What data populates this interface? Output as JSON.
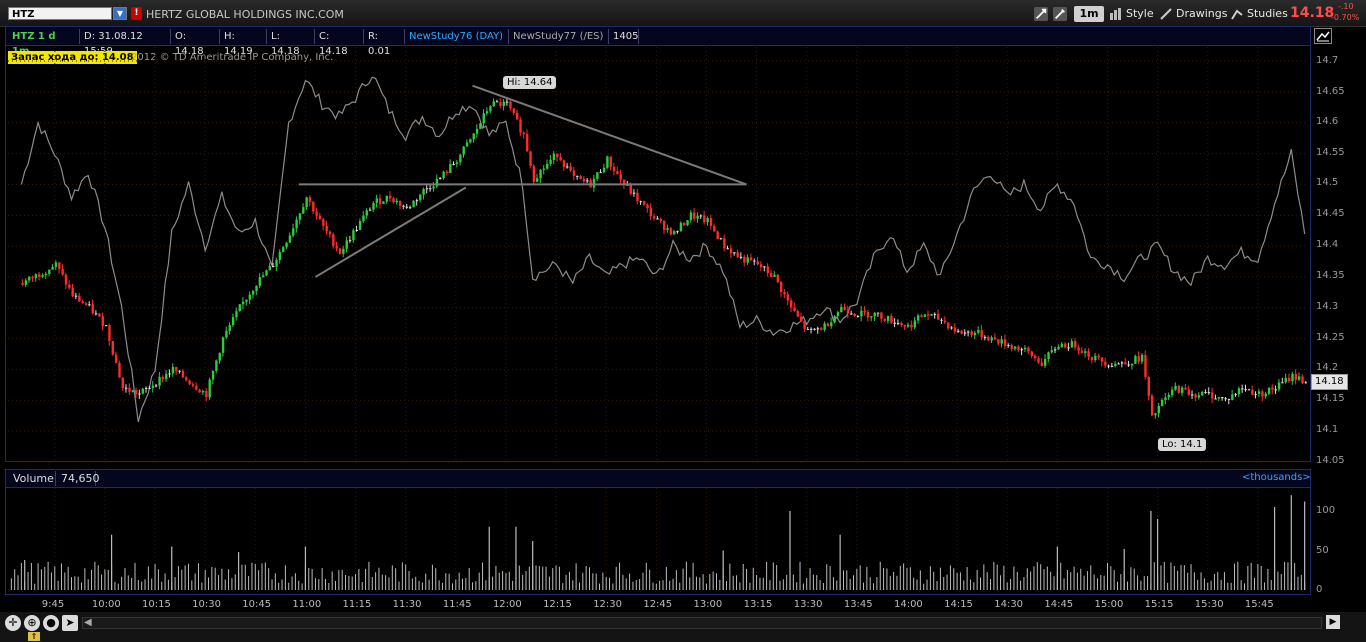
{
  "toolbar": {
    "symbol": "HTZ",
    "company": "HERTZ GLOBAL HOLDINGS INC.COM",
    "info_icon": "!",
    "timeframe": "1m",
    "style_label": "Style",
    "drawings_label": "Drawings",
    "studies_label": "Studies",
    "last_price": "14.18",
    "change_abs": "-.10",
    "change_pct": "-0.70%"
  },
  "infobar": {
    "symbol_period": "HTZ 1 d 1m",
    "date": "D: 31.08.12 15:59",
    "open": "O: 14.18",
    "high": "H: 14.19",
    "low": "L: 14.18",
    "close": "C: 14.18",
    "range": "R: 0.01",
    "study76": "NewStudy76 (DAY)",
    "study77": "NewStudy77 (/ES)",
    "study77_value": "1405"
  },
  "overlay": {
    "distance_label": "Запас хода до: 14.08",
    "copyright": "2012 © TD Ameritrade IP Company, Inc.",
    "hi_label": "Hi: 14.64",
    "lo_label": "Lo: 14.1",
    "current_price": "14.18"
  },
  "volume": {
    "label": "Volume",
    "value": "74,650",
    "units": "<thousands>"
  },
  "chart_data": {
    "type": "candlestick",
    "symbol": "HTZ",
    "interval": "1m",
    "high": 14.64,
    "low": 14.1,
    "last": 14.18,
    "y_ticks": [
      "14.7",
      "14.65",
      "14.6",
      "14.55",
      "14.5",
      "14.45",
      "14.4",
      "14.35",
      "14.3",
      "14.25",
      "14.2",
      "14.15",
      "14.1",
      "14.05"
    ],
    "y_range": [
      14.05,
      14.7
    ],
    "x_ticks": [
      "9:45",
      "10:00",
      "10:15",
      "10:30",
      "10:45",
      "11:00",
      "11:15",
      "11:30",
      "11:45",
      "12:00",
      "12:15",
      "12:30",
      "12:45",
      "13:00",
      "13:15",
      "13:30",
      "13:45",
      "14:00",
      "14:15",
      "14:30",
      "14:45",
      "15:00",
      "15:15",
      "15:30",
      "15:45"
    ],
    "volume_ticks": [
      "100",
      "50",
      "0"
    ],
    "price_path": [
      {
        "t": "9:35",
        "p": 14.34
      },
      {
        "t": "9:45",
        "p": 14.37
      },
      {
        "t": "9:50",
        "p": 14.32
      },
      {
        "t": "9:55",
        "p": 14.3
      },
      {
        "t": "10:00",
        "p": 14.27
      },
      {
        "t": "10:05",
        "p": 14.17
      },
      {
        "t": "10:10",
        "p": 14.16
      },
      {
        "t": "10:15",
        "p": 14.18
      },
      {
        "t": "10:20",
        "p": 14.2
      },
      {
        "t": "10:25",
        "p": 14.18
      },
      {
        "t": "10:30",
        "p": 14.16
      },
      {
        "t": "10:35",
        "p": 14.25
      },
      {
        "t": "10:40",
        "p": 14.3
      },
      {
        "t": "10:45",
        "p": 14.34
      },
      {
        "t": "10:50",
        "p": 14.37
      },
      {
        "t": "10:55",
        "p": 14.42
      },
      {
        "t": "11:00",
        "p": 14.48
      },
      {
        "t": "11:05",
        "p": 14.43
      },
      {
        "t": "11:10",
        "p": 14.39
      },
      {
        "t": "11:15",
        "p": 14.43
      },
      {
        "t": "11:20",
        "p": 14.47
      },
      {
        "t": "11:25",
        "p": 14.48
      },
      {
        "t": "11:30",
        "p": 14.46
      },
      {
        "t": "11:35",
        "p": 14.49
      },
      {
        "t": "11:40",
        "p": 14.51
      },
      {
        "t": "11:45",
        "p": 14.54
      },
      {
        "t": "11:50",
        "p": 14.58
      },
      {
        "t": "11:55",
        "p": 14.63
      },
      {
        "t": "12:00",
        "p": 14.63
      },
      {
        "t": "12:05",
        "p": 14.58
      },
      {
        "t": "12:08",
        "p": 14.51
      },
      {
        "t": "12:15",
        "p": 14.55
      },
      {
        "t": "12:20",
        "p": 14.51
      },
      {
        "t": "12:25",
        "p": 14.5
      },
      {
        "t": "12:30",
        "p": 14.54
      },
      {
        "t": "12:35",
        "p": 14.5
      },
      {
        "t": "12:40",
        "p": 14.47
      },
      {
        "t": "12:45",
        "p": 14.44
      },
      {
        "t": "12:50",
        "p": 14.42
      },
      {
        "t": "12:55",
        "p": 14.45
      },
      {
        "t": "13:00",
        "p": 14.44
      },
      {
        "t": "13:05",
        "p": 14.4
      },
      {
        "t": "13:10",
        "p": 14.38
      },
      {
        "t": "13:15",
        "p": 14.37
      },
      {
        "t": "13:20",
        "p": 14.35
      },
      {
        "t": "13:25",
        "p": 14.3
      },
      {
        "t": "13:30",
        "p": 14.26
      },
      {
        "t": "13:35",
        "p": 14.27
      },
      {
        "t": "13:40",
        "p": 14.3
      },
      {
        "t": "13:45",
        "p": 14.29
      },
      {
        "t": "13:50",
        "p": 14.29
      },
      {
        "t": "13:55",
        "p": 14.28
      },
      {
        "t": "14:00",
        "p": 14.27
      },
      {
        "t": "14:05",
        "p": 14.29
      },
      {
        "t": "14:10",
        "p": 14.28
      },
      {
        "t": "14:15",
        "p": 14.26
      },
      {
        "t": "14:20",
        "p": 14.26
      },
      {
        "t": "14:25",
        "p": 14.25
      },
      {
        "t": "14:30",
        "p": 14.24
      },
      {
        "t": "14:35",
        "p": 14.23
      },
      {
        "t": "14:40",
        "p": 14.21
      },
      {
        "t": "14:45",
        "p": 14.24
      },
      {
        "t": "14:50",
        "p": 14.24
      },
      {
        "t": "14:55",
        "p": 14.22
      },
      {
        "t": "15:00",
        "p": 14.21
      },
      {
        "t": "15:05",
        "p": 14.21
      },
      {
        "t": "15:10",
        "p": 14.22
      },
      {
        "t": "15:13",
        "p": 14.12
      },
      {
        "t": "15:15",
        "p": 14.14
      },
      {
        "t": "15:20",
        "p": 14.17
      },
      {
        "t": "15:25",
        "p": 14.16
      },
      {
        "t": "15:30",
        "p": 14.16
      },
      {
        "t": "15:35",
        "p": 14.15
      },
      {
        "t": "15:40",
        "p": 14.17
      },
      {
        "t": "15:45",
        "p": 14.16
      },
      {
        "t": "15:50",
        "p": 14.17
      },
      {
        "t": "15:55",
        "p": 14.19
      },
      {
        "t": "15:59",
        "p": 14.18
      }
    ],
    "comparison_path": [
      {
        "t": "9:35",
        "p": 14.5
      },
      {
        "t": "9:40",
        "p": 14.6
      },
      {
        "t": "9:45",
        "p": 14.55
      },
      {
        "t": "9:50",
        "p": 14.48
      },
      {
        "t": "9:55",
        "p": 14.52
      },
      {
        "t": "10:00",
        "p": 14.43
      },
      {
        "t": "10:05",
        "p": 14.3
      },
      {
        "t": "10:10",
        "p": 14.12
      },
      {
        "t": "10:15",
        "p": 14.2
      },
      {
        "t": "10:20",
        "p": 14.42
      },
      {
        "t": "10:25",
        "p": 14.5
      },
      {
        "t": "10:30",
        "p": 14.4
      },
      {
        "t": "10:35",
        "p": 14.48
      },
      {
        "t": "10:40",
        "p": 14.42
      },
      {
        "t": "10:45",
        "p": 14.44
      },
      {
        "t": "10:50",
        "p": 14.36
      },
      {
        "t": "10:55",
        "p": 14.6
      },
      {
        "t": "11:00",
        "p": 14.67
      },
      {
        "t": "11:05",
        "p": 14.63
      },
      {
        "t": "11:10",
        "p": 14.61
      },
      {
        "t": "11:15",
        "p": 14.64
      },
      {
        "t": "11:20",
        "p": 14.68
      },
      {
        "t": "11:25",
        "p": 14.62
      },
      {
        "t": "11:30",
        "p": 14.58
      },
      {
        "t": "11:35",
        "p": 14.61
      },
      {
        "t": "11:40",
        "p": 14.58
      },
      {
        "t": "11:45",
        "p": 14.62
      },
      {
        "t": "11:50",
        "p": 14.63
      },
      {
        "t": "11:55",
        "p": 14.58
      },
      {
        "t": "12:00",
        "p": 14.6
      },
      {
        "t": "12:05",
        "p": 14.5
      },
      {
        "t": "12:08",
        "p": 14.35
      },
      {
        "t": "12:15",
        "p": 14.37
      },
      {
        "t": "12:20",
        "p": 14.34
      },
      {
        "t": "12:25",
        "p": 14.38
      },
      {
        "t": "12:30",
        "p": 14.35
      },
      {
        "t": "12:35",
        "p": 14.37
      },
      {
        "t": "12:40",
        "p": 14.38
      },
      {
        "t": "12:45",
        "p": 14.35
      },
      {
        "t": "12:50",
        "p": 14.4
      },
      {
        "t": "12:55",
        "p": 14.38
      },
      {
        "t": "13:00",
        "p": 14.4
      },
      {
        "t": "13:05",
        "p": 14.36
      },
      {
        "t": "13:10",
        "p": 14.27
      },
      {
        "t": "13:15",
        "p": 14.28
      },
      {
        "t": "13:20",
        "p": 14.26
      },
      {
        "t": "13:25",
        "p": 14.27
      },
      {
        "t": "13:30",
        "p": 14.28
      },
      {
        "t": "13:35",
        "p": 14.3
      },
      {
        "t": "13:40",
        "p": 14.28
      },
      {
        "t": "13:45",
        "p": 14.31
      },
      {
        "t": "13:50",
        "p": 14.38
      },
      {
        "t": "13:55",
        "p": 14.42
      },
      {
        "t": "14:00",
        "p": 14.36
      },
      {
        "t": "14:05",
        "p": 14.4
      },
      {
        "t": "14:10",
        "p": 14.35
      },
      {
        "t": "14:15",
        "p": 14.42
      },
      {
        "t": "14:20",
        "p": 14.49
      },
      {
        "t": "14:25",
        "p": 14.52
      },
      {
        "t": "14:30",
        "p": 14.48
      },
      {
        "t": "14:35",
        "p": 14.5
      },
      {
        "t": "14:40",
        "p": 14.46
      },
      {
        "t": "14:45",
        "p": 14.5
      },
      {
        "t": "14:50",
        "p": 14.47
      },
      {
        "t": "14:55",
        "p": 14.38
      },
      {
        "t": "15:00",
        "p": 14.37
      },
      {
        "t": "15:05",
        "p": 14.35
      },
      {
        "t": "15:10",
        "p": 14.38
      },
      {
        "t": "15:15",
        "p": 14.4
      },
      {
        "t": "15:20",
        "p": 14.36
      },
      {
        "t": "15:25",
        "p": 14.34
      },
      {
        "t": "15:30",
        "p": 14.38
      },
      {
        "t": "15:35",
        "p": 14.37
      },
      {
        "t": "15:40",
        "p": 14.39
      },
      {
        "t": "15:45",
        "p": 14.38
      },
      {
        "t": "15:50",
        "p": 14.47
      },
      {
        "t": "15:55",
        "p": 14.55
      },
      {
        "t": "15:59",
        "p": 14.42
      }
    ],
    "trendlines": [
      {
        "name": "support-line",
        "from": {
          "t": "11:03",
          "p": 14.35
        },
        "to": {
          "t": "11:48",
          "p": 14.495
        }
      },
      {
        "name": "horizontal-line",
        "from": {
          "t": "10:58",
          "p": 14.5
        },
        "to": {
          "t": "13:12",
          "p": 14.5
        }
      },
      {
        "name": "resistance-line",
        "from": {
          "t": "11:50",
          "p": 14.66
        },
        "to": {
          "t": "13:12",
          "p": 14.5
        }
      }
    ],
    "volume_spikes": [
      {
        "t": "9:36",
        "v": 38
      },
      {
        "t": "10:02",
        "v": 70
      },
      {
        "t": "10:20",
        "v": 55
      },
      {
        "t": "10:40",
        "v": 48
      },
      {
        "t": "11:00",
        "v": 55
      },
      {
        "t": "11:55",
        "v": 80
      },
      {
        "t": "12:03",
        "v": 80
      },
      {
        "t": "12:08",
        "v": 62
      },
      {
        "t": "13:05",
        "v": 50
      },
      {
        "t": "13:25",
        "v": 100
      },
      {
        "t": "13:40",
        "v": 70
      },
      {
        "t": "14:45",
        "v": 55
      },
      {
        "t": "15:05",
        "v": 52
      },
      {
        "t": "15:13",
        "v": 100
      },
      {
        "t": "15:15",
        "v": 90
      },
      {
        "t": "15:50",
        "v": 105
      },
      {
        "t": "15:55",
        "v": 120
      },
      {
        "t": "15:59",
        "v": 112
      }
    ],
    "colors": {
      "up": "#2ecc40",
      "down": "#ff2a2a",
      "doji": "#dddddd",
      "comparison": "#8c8c8c",
      "trendline": "#7a7a7a",
      "volume": "#bdbdbd"
    }
  }
}
